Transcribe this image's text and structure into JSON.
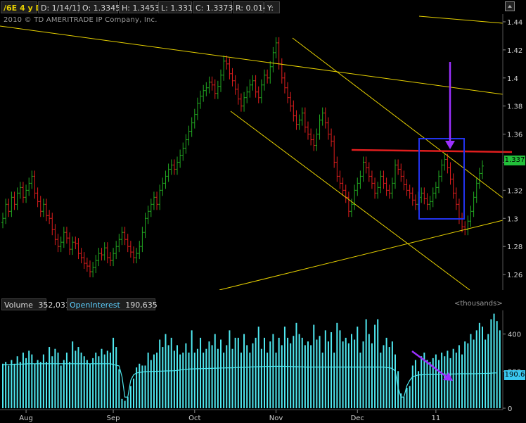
{
  "header": {
    "symbol": "/6E 4 y D",
    "date": "D: 1/14/11",
    "open": "O: 1.3345",
    "high": "H: 1.3453",
    "low": "L: 1.331",
    "close": "C: 1.3373",
    "range": "R: 0.0143",
    "y": "Y:"
  },
  "copyright": "2010 © TD AMERITRADE IP Company, Inc.",
  "price_axis": {
    "ticks": [
      "1.44",
      "1.42",
      "1.4",
      "1.38",
      "1.36",
      "1.34",
      "1.32",
      "1.3",
      "1.28",
      "1.26"
    ],
    "current_price": "1.337"
  },
  "volume_panel": {
    "volume_label": "Volume",
    "volume_value": "352,031",
    "oi_label": "OpenInterest",
    "oi_value": "190,635",
    "units": "<thousands>",
    "ticks": [
      "400",
      "200",
      "0"
    ],
    "oi_tag": "190.6"
  },
  "time_axis": [
    "Aug",
    "Sep",
    "Oct",
    "Nov",
    "Dec",
    "11"
  ],
  "colors": {
    "up": "#22aa22",
    "down": "#e01e1e",
    "trendline": "#e6d000",
    "resistance": "#e01e1e",
    "box": "#2233ee",
    "arrow": "#9b30ff",
    "volume": "#4fe8f0",
    "price_tag": "#22c03a",
    "oi_tag": "#39c8f0"
  },
  "chart_data": [
    {
      "type": "candlestick",
      "title": "/6E 4 y D",
      "ylim": [
        1.25,
        1.445
      ],
      "x": [
        "Aug",
        "Sep",
        "Oct",
        "Nov",
        "Dec",
        "11"
      ],
      "series": [
        {
          "close": [
            1.3,
            1.31,
            1.305,
            1.315,
            1.31,
            1.318,
            1.322,
            1.315,
            1.32,
            1.325,
            1.33,
            1.318,
            1.312,
            1.305,
            1.31,
            1.302,
            1.3,
            1.292,
            1.285,
            1.28,
            1.283,
            1.29,
            1.286,
            1.278,
            1.283,
            1.282,
            1.275,
            1.272,
            1.268,
            1.266,
            1.262,
            1.265,
            1.27,
            1.275,
            1.274,
            1.279,
            1.272,
            1.27,
            1.275,
            1.28,
            1.285,
            1.29,
            1.285,
            1.28,
            1.276,
            1.272,
            1.275,
            1.28,
            1.29,
            1.3,
            1.305,
            1.31,
            1.315,
            1.31,
            1.32,
            1.325,
            1.33,
            1.335,
            1.338,
            1.335,
            1.34,
            1.345,
            1.35,
            1.356,
            1.362,
            1.368,
            1.374,
            1.382,
            1.387,
            1.391,
            1.393,
            1.397,
            1.395,
            1.389,
            1.394,
            1.402,
            1.412,
            1.41,
            1.403,
            1.398,
            1.392,
            1.385,
            1.38,
            1.386,
            1.39,
            1.395,
            1.398,
            1.39,
            1.386,
            1.395,
            1.402,
            1.4,
            1.408,
            1.418,
            1.425,
            1.41,
            1.4,
            1.393,
            1.386,
            1.38,
            1.373,
            1.367,
            1.37,
            1.375,
            1.365,
            1.36,
            1.356,
            1.352,
            1.36,
            1.37,
            1.375,
            1.368,
            1.36,
            1.355,
            1.34,
            1.33,
            1.325,
            1.32,
            1.315,
            1.305,
            1.31,
            1.32,
            1.325,
            1.33,
            1.34,
            1.336,
            1.33,
            1.325,
            1.318,
            1.322,
            1.33,
            1.325,
            1.32,
            1.318,
            1.325,
            1.338,
            1.335,
            1.33,
            1.324,
            1.32,
            1.318,
            1.313,
            1.31,
            1.315,
            1.318,
            1.314,
            1.31,
            1.312,
            1.318,
            1.322,
            1.33,
            1.338,
            1.342,
            1.336,
            1.328,
            1.318,
            1.31,
            1.3,
            1.294,
            1.292,
            1.298,
            1.305,
            1.315,
            1.325,
            1.332,
            1.3373
          ]
        },
        {
          "name": "Volume",
          "values": [
            240,
            250,
            230,
            260,
            240,
            280,
            250,
            300,
            270,
            310,
            290,
            240,
            260,
            250,
            290,
            250,
            330,
            280,
            320,
            300,
            230,
            260,
            300,
            250,
            360,
            310,
            330,
            300,
            280,
            260,
            240,
            270,
            300,
            280,
            320,
            290,
            310,
            300,
            380,
            330,
            210,
            50,
            40,
            60,
            120,
            160,
            220,
            240,
            230,
            230,
            300,
            260,
            290,
            300,
            370,
            330,
            400,
            340,
            380,
            310,
            340,
            290,
            300,
            350,
            300,
            420,
            300,
            320,
            380,
            300,
            320,
            360,
            340,
            400,
            320,
            370,
            300,
            340,
            420,
            320,
            380,
            380,
            300,
            400,
            340,
            300,
            350,
            380,
            440,
            320,
            380,
            300,
            360,
            400,
            300,
            380,
            340,
            440,
            380,
            350,
            390,
            460,
            400,
            380,
            340,
            360,
            340,
            450,
            370,
            390,
            300,
            420,
            360,
            410,
            300,
            460,
            420,
            360,
            380,
            350,
            400,
            370,
            440,
            300,
            360,
            480,
            400,
            350,
            450,
            480,
            300,
            340,
            380,
            330,
            360,
            290,
            200,
            80,
            60,
            110,
            120,
            230,
            260,
            200,
            280,
            300,
            260,
            250,
            270,
            290,
            260,
            300,
            280,
            310,
            270,
            320,
            300,
            340,
            290,
            360,
            350,
            400,
            370,
            420,
            460,
            440,
            370,
            400,
            480,
            510,
            470,
            420
          ]
        },
        {
          "name": "OpenInterest",
          "values": [
            235,
            235,
            236,
            236,
            237,
            238,
            238,
            238,
            239,
            240,
            240,
            240,
            240,
            240,
            240,
            240,
            240,
            240,
            240,
            240,
            240,
            240,
            240,
            240,
            240,
            240,
            240,
            240,
            240,
            240,
            240,
            240,
            240,
            240,
            240,
            240,
            240,
            240,
            236,
            232,
            228,
            170,
            60,
            60,
            150,
            180,
            190,
            193,
            195,
            197,
            198,
            198,
            199,
            199,
            200,
            200,
            201,
            201,
            202,
            202,
            204,
            206,
            208,
            210,
            211,
            212,
            212,
            213,
            213,
            214,
            214,
            215,
            215,
            216,
            216,
            217,
            217,
            218,
            218,
            218,
            219,
            220,
            220,
            221,
            221,
            222,
            223,
            223,
            224,
            224,
            225,
            225,
            225,
            226,
            226,
            226,
            226,
            226,
            225,
            225,
            224,
            224,
            223,
            223,
            222,
            222,
            222,
            222,
            222,
            222,
            222,
            222,
            222,
            222,
            222,
            222,
            222,
            222,
            222,
            222,
            222,
            222,
            222,
            222,
            222,
            222,
            222,
            222,
            222,
            222,
            222,
            222,
            220,
            218,
            214,
            200,
            110,
            60,
            60,
            120,
            150,
            170,
            175,
            180,
            180,
            181,
            181,
            182,
            182,
            182,
            183,
            183,
            184,
            184,
            184,
            185,
            185,
            186,
            186,
            186,
            186,
            186,
            186,
            186,
            187,
            187,
            188,
            188,
            189,
            190,
            190.6
          ]
        }
      ]
    }
  ]
}
